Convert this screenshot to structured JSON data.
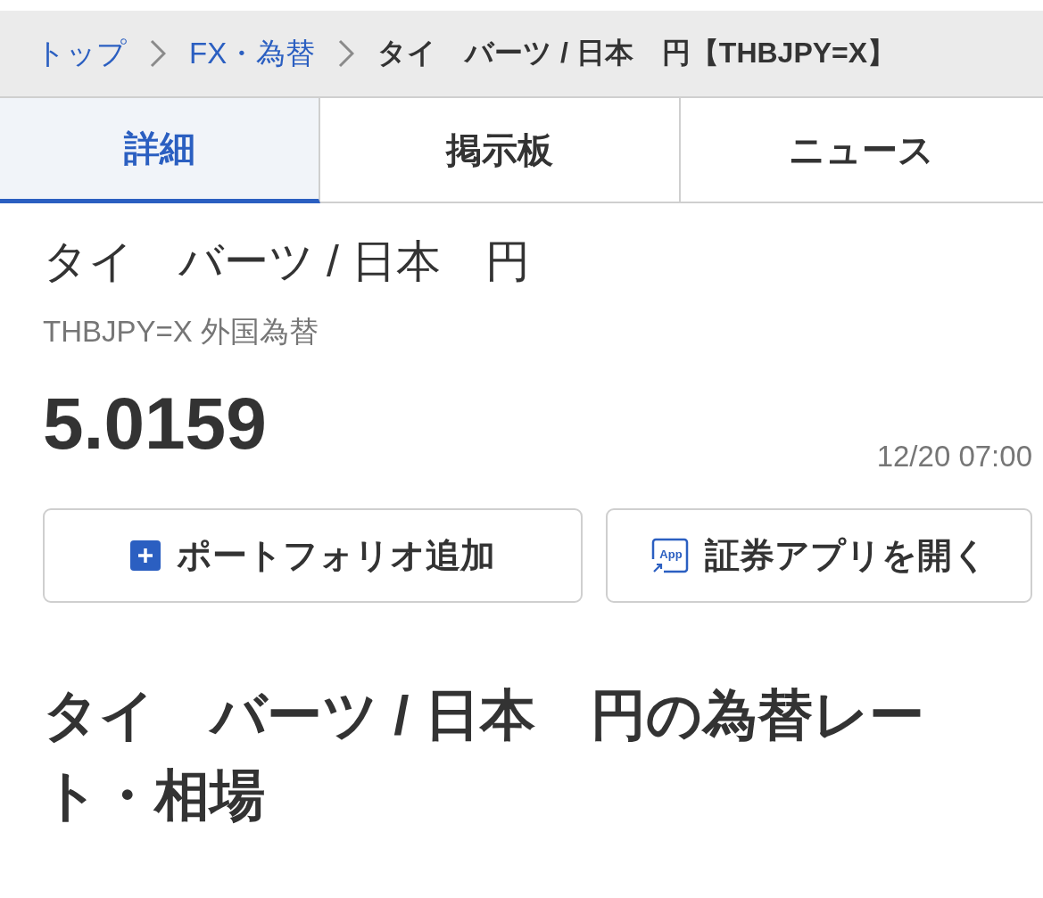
{
  "breadcrumb": {
    "links": [
      {
        "label": "トップ"
      },
      {
        "label": "FX・為替"
      }
    ],
    "current": "タイ　バーツ / 日本　円【THBJPY=X】"
  },
  "tabs": [
    {
      "label": "詳細",
      "selected": true
    },
    {
      "label": "掲示板",
      "selected": false
    },
    {
      "label": "ニュース",
      "selected": false
    }
  ],
  "quote": {
    "name": "タイ　バーツ / 日本　円",
    "code_line": "THBJPY=X 外国為替",
    "price": "5.0159",
    "time": "12/20 07:00"
  },
  "buttons": [
    {
      "kind": "add",
      "label": "ポートフォリオ追加"
    },
    {
      "kind": "app",
      "label": "証券アプリを開く",
      "icon_text": "App"
    }
  ],
  "section_heading": "タイ　バーツ / 日本　円の為替レート・相場"
}
